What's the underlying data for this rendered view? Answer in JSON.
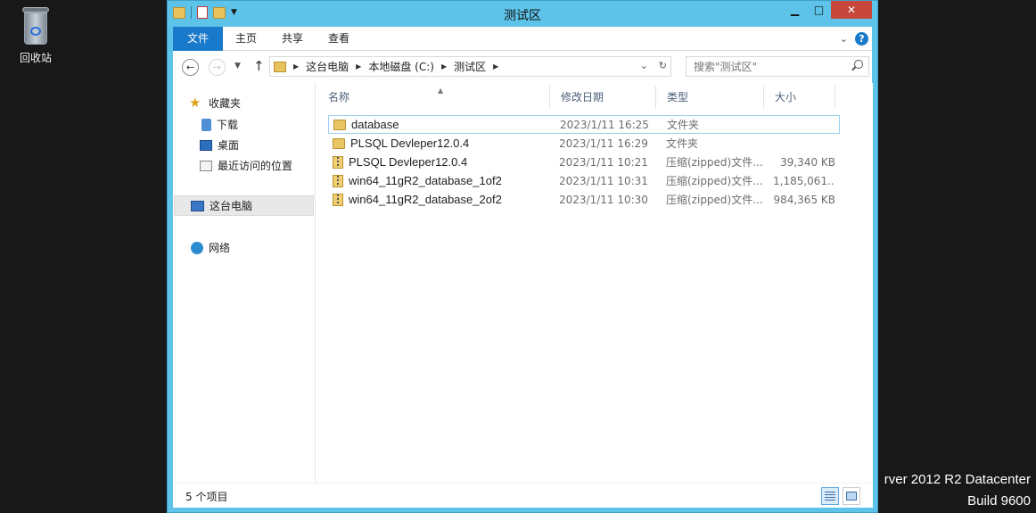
{
  "desktop": {
    "recycle_bin_label": "回收站",
    "watermark_line1": "rver 2012 R2 Datacenter",
    "watermark_line2": "Build 9600"
  },
  "window": {
    "title": "测试区",
    "caption_buttons": {
      "minimize": "▁",
      "maximize": "□",
      "close": "✕"
    },
    "ribbon_tabs": [
      "文件",
      "主页",
      "共享",
      "查看"
    ],
    "help_label": "?"
  },
  "navbar": {
    "breadcrumbs": [
      "这台电脑",
      "本地磁盘 (C:)",
      "测试区"
    ],
    "search_placeholder": "搜索\"测试区\""
  },
  "sidebar": {
    "favorites_label": "收藏夹",
    "favorites": [
      "下载",
      "桌面",
      "最近访问的位置"
    ],
    "this_pc_label": "这台电脑",
    "network_label": "网络"
  },
  "columns": {
    "name": "名称",
    "modified": "修改日期",
    "type": "类型",
    "size": "大小"
  },
  "files": [
    {
      "name": "database",
      "modified": "2023/1/11 16:25",
      "type": "文件夹",
      "size": "",
      "kind": "folder"
    },
    {
      "name": "PLSQL Devleper12.0.4",
      "modified": "2023/1/11 16:29",
      "type": "文件夹",
      "size": "",
      "kind": "folder"
    },
    {
      "name": "PLSQL Devleper12.0.4",
      "modified": "2023/1/11 10:21",
      "type": "压缩(zipped)文件...",
      "size": "39,340 KB",
      "kind": "zip"
    },
    {
      "name": "win64_11gR2_database_1of2",
      "modified": "2023/1/11 10:31",
      "type": "压缩(zipped)文件...",
      "size": "1,185,061...",
      "kind": "zip"
    },
    {
      "name": "win64_11gR2_database_2of2",
      "modified": "2023/1/11 10:30",
      "type": "压缩(zipped)文件...",
      "size": "984,365 KB",
      "kind": "zip"
    }
  ],
  "statusbar": {
    "item_count": "5 个项目"
  }
}
